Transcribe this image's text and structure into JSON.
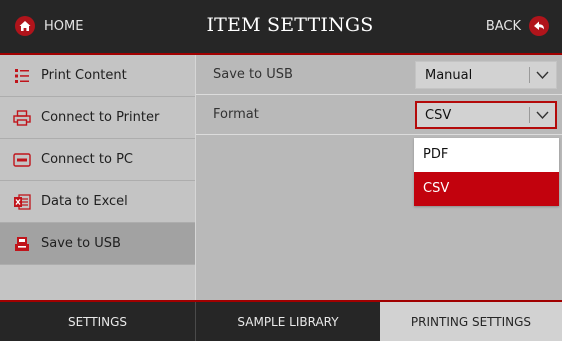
{
  "header": {
    "home_label": "HOME",
    "title": "ITEM SETTINGS",
    "back_label": "BACK"
  },
  "sidebar": {
    "items": [
      {
        "label": "Print Content",
        "icon": "list-icon",
        "active": false
      },
      {
        "label": "Connect to Printer",
        "icon": "printer-icon",
        "active": false
      },
      {
        "label": "Connect to PC",
        "icon": "pc-cmd-icon",
        "active": false
      },
      {
        "label": "Data to Excel",
        "icon": "excel-icon",
        "active": false
      },
      {
        "label": "Save to USB",
        "icon": "usb-save-icon",
        "active": true
      }
    ]
  },
  "settings": {
    "save_to_usb": {
      "label": "Save to USB",
      "value": "Manual"
    },
    "format": {
      "label": "Format",
      "value": "CSV",
      "open": true
    }
  },
  "dropdown": {
    "options": [
      "PDF",
      "CSV"
    ],
    "selected": "CSV"
  },
  "tabs": [
    {
      "label": "SETTINGS",
      "active": false
    },
    {
      "label": "SAMPLE LIBRARY",
      "active": false
    },
    {
      "label": "PRINTING SETTINGS",
      "active": true
    }
  ],
  "colors": {
    "accent": "#c2020d",
    "header_bg": "#262626",
    "panel_bg": "#b9b9b9"
  }
}
